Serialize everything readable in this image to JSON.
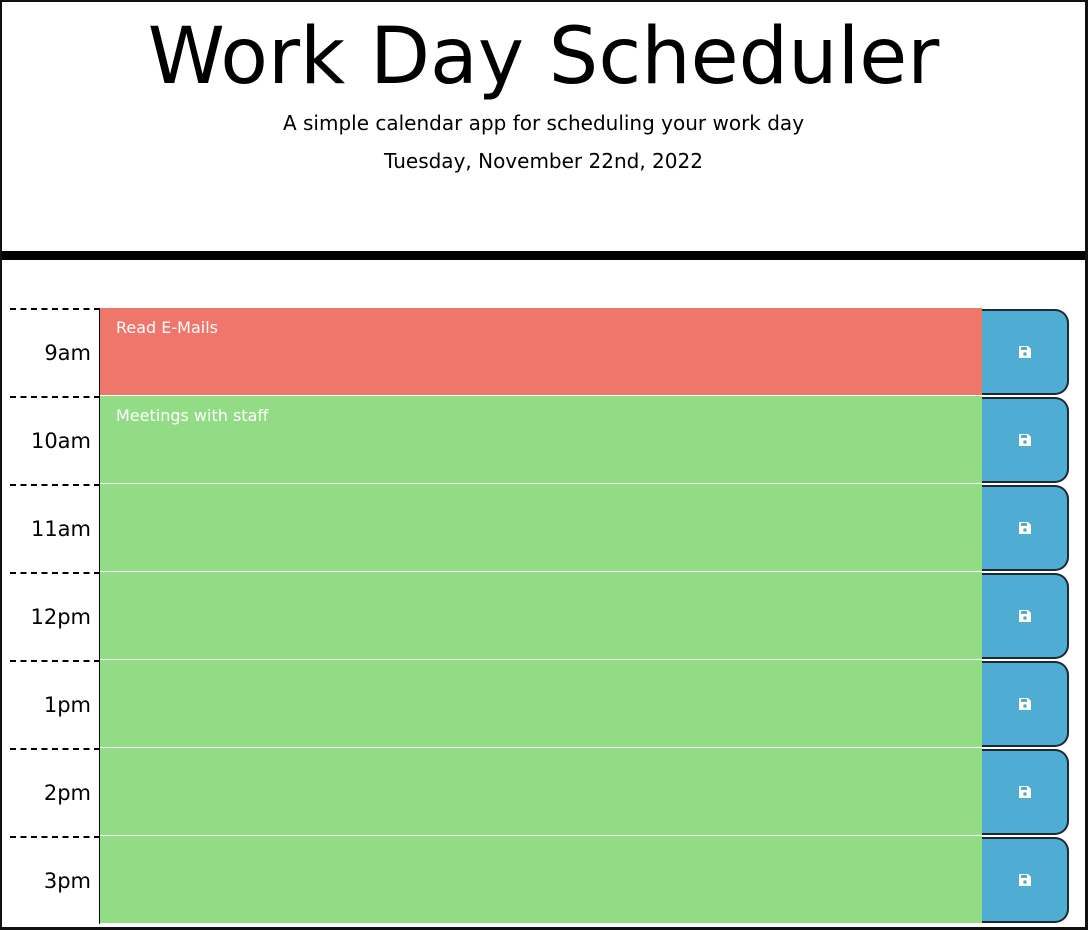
{
  "header": {
    "title": "Work Day Scheduler",
    "subtitle": "A simple calendar app for scheduling your work day",
    "current_date": "Tuesday, November 22nd, 2022"
  },
  "colors": {
    "present": "#ee766a",
    "future": "#92dc86",
    "past": "#d3d3d3",
    "save_button": "#4fadd4"
  },
  "rows": [
    {
      "hour": "9am",
      "text": "Read E-Mails",
      "state": "present",
      "save_icon": "save-icon"
    },
    {
      "hour": "10am",
      "text": "Meetings with staff",
      "state": "future",
      "save_icon": "save-icon"
    },
    {
      "hour": "11am",
      "text": "",
      "state": "future",
      "save_icon": "save-icon"
    },
    {
      "hour": "12pm",
      "text": "",
      "state": "future",
      "save_icon": "save-icon"
    },
    {
      "hour": "1pm",
      "text": "",
      "state": "future",
      "save_icon": "save-icon"
    },
    {
      "hour": "2pm",
      "text": "",
      "state": "future",
      "save_icon": "save-icon"
    },
    {
      "hour": "3pm",
      "text": "",
      "state": "future",
      "save_icon": "save-icon"
    }
  ]
}
